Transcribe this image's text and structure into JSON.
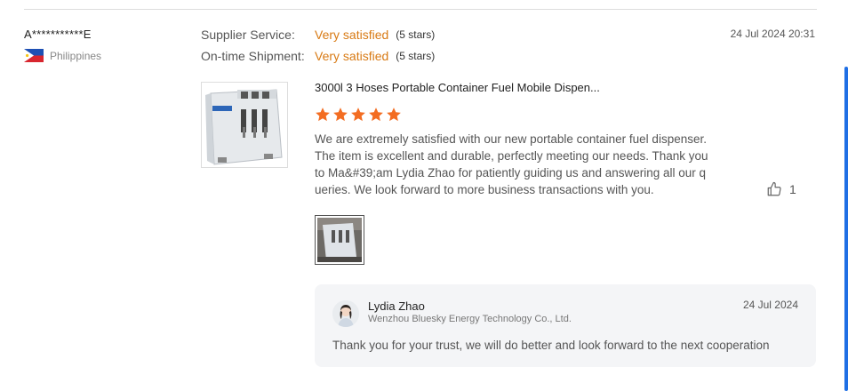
{
  "review": {
    "reviewer_name": "A***********E",
    "country": "Philippines",
    "date": "24 Jul 2024 20:31",
    "supplier_service": {
      "label": "Supplier Service:",
      "value": "Very satisfied",
      "stars_note": "(5 stars)"
    },
    "ontime_shipment": {
      "label": "On-time Shipment:",
      "value": "Very satisfied",
      "stars_note": "(5 stars)"
    },
    "product_title": "3000l 3 Hoses Portable Container Fuel Mobile Dispen...",
    "rating": 5,
    "text": "We are extremely satisfied with our new portable container fuel dispenser. The item is excellent and durable, perfectly meeting our needs. Thank you to Ma&#39;am Lydia Zhao for patiently guiding us and answering all our queries. We look forward to more business transactions with you.",
    "like_count": "1"
  },
  "reply": {
    "name": "Lydia Zhao",
    "company": "Wenzhou Bluesky Energy Technology Co., Ltd.",
    "date": "24 Jul 2024",
    "text": "Thank you for your trust, we will do better and look forward to the next cooperation"
  },
  "colors": {
    "accent_orange": "#d87a14",
    "star_orange": "#f36d22",
    "scrollbar_blue": "#1f6fe5",
    "reply_bg": "#f4f5f7"
  },
  "icons": {
    "flag": "philippines-flag-icon",
    "star": "star-icon",
    "like": "thumbs-up-icon"
  }
}
